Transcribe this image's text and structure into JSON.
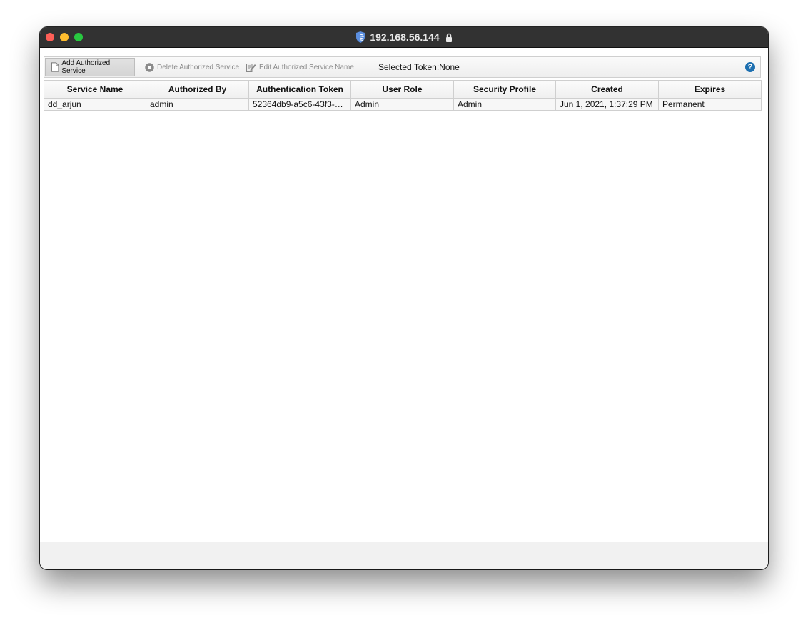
{
  "window": {
    "title": "192.168.56.144",
    "icons": {
      "site": "shield-icon",
      "secure": "lock-icon"
    }
  },
  "toolbar": {
    "add_label": "Add Authorized Service",
    "delete_label": "Delete Authorized Service",
    "edit_label": "Edit Authorized Service Name",
    "selected_token_label": "Selected Token:None",
    "help_label": "?"
  },
  "table": {
    "columns": [
      "Service Name",
      "Authorized By",
      "Authentication Token",
      "User Role",
      "Security Profile",
      "Created",
      "Expires"
    ],
    "rows": [
      [
        "dd_arjun",
        "admin",
        "52364db9-a5c6-43f3-a…",
        "Admin",
        "Admin",
        "Jun 1, 2021, 1:37:29 PM",
        "Permanent"
      ]
    ]
  },
  "colors": {
    "titlebar": "#323232",
    "accent_help": "#1d6fb0",
    "shield": "#5b8fe0"
  }
}
